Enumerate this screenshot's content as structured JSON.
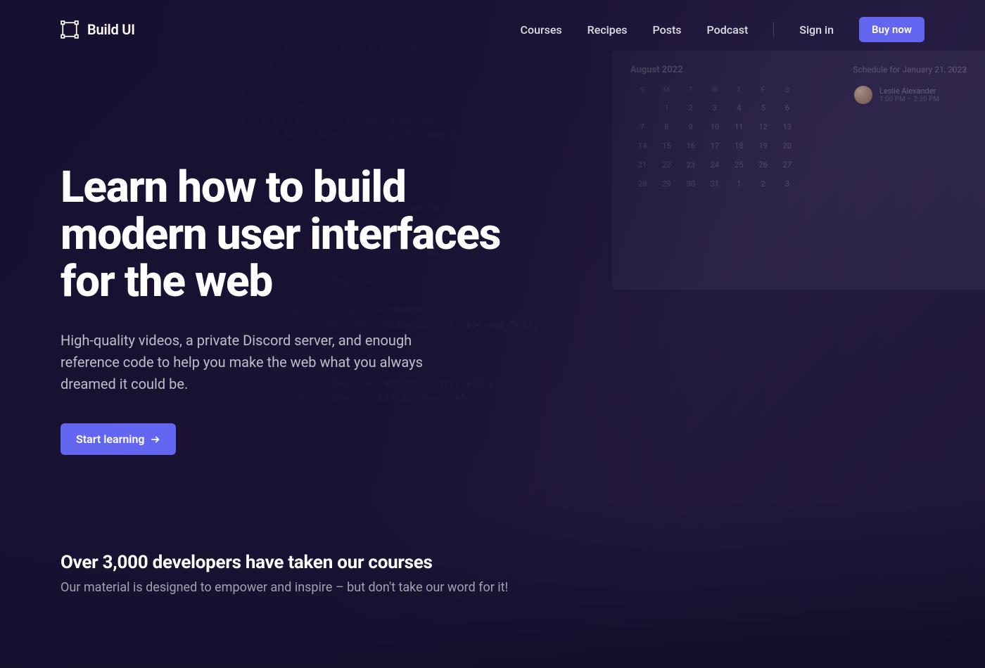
{
  "brand": {
    "name": "Build UI"
  },
  "nav": {
    "links": [
      "Courses",
      "Recipes",
      "Posts",
      "Podcast"
    ],
    "signin": "Sign in",
    "buy": "Buy now"
  },
  "hero": {
    "title": "Learn how to build modern user interfaces for the web",
    "subtitle": "High-quality videos, a private Discord server, and enough reference code to help you make the web what you always dreamed it could be.",
    "cta": "Start learning"
  },
  "social": {
    "headline": "Over 3,000 developers have taken our courses",
    "sub": "Our material is designed to empower and inspire – but don't take our word for it!"
  },
  "calendar": {
    "month": "August 2022",
    "schedule_title": "Schedule for January 21, 2022",
    "dows": [
      "S",
      "M",
      "T",
      "W",
      "T",
      "F",
      "S"
    ],
    "weeks": [
      [
        "",
        "1",
        "2",
        "3",
        "4",
        "5",
        "6"
      ],
      [
        "7",
        "8",
        "9",
        "10",
        "11",
        "12",
        "13"
      ],
      [
        "14",
        "15",
        "16",
        "17",
        "18",
        "19",
        "20"
      ],
      [
        "21",
        "22",
        "23",
        "24",
        "25",
        "26",
        "27"
      ],
      [
        "28",
        "29",
        "30",
        "31",
        "1",
        "2",
        "3"
      ]
    ],
    "event": {
      "name": "Leslie Alexander",
      "time": "1:00 PM – 2:30 PM"
    }
  },
  "code_lines": [
    "<div className=\"grid grid-cols-7 mt-2 text-sm\">",
    "  {newDays.map((day, dayIdx) => (",
    "    <div",
    "      key={day.toString()}",
    "      className={classNames(",
    "        dayIdx > 6 && 'border-t ▮border-gray-200',",
    "        dayIdx === 0 && colStartClasses[getDay(day)],",
    "        'py-2'",
    "      )}",
    "    >",
    "      <button",
    "        isEqual(day, selectedDay) && '▮text-white',",
    "        !isEqual(day, selectedDay) &&",
    "        isToday(day) &&",
    "        isSameMonth(day, firstDayCurrentMonth) &&",
    "        'text-gray-900',",
    "        !isEqual(day, selectedDay) &&",
    "        !isToday(day) &&",
    "        !isSameMonth(day, firstDayCurrentMonth) &&",
    "        isEqual(day, selectedDay) && isToday(day) && '▮bg-red-500',",
    "        !isEqual(day, selectedDay) &&",
    "        !isToday(day) &&",
    "        '▮bg-gray-900',",
    "        !isEqual(day, selectedDay) && '▮hover:bg-gray-200',",
    "        (isEqual(day, selectedDay) || isToday(day)) &&"
  ]
}
